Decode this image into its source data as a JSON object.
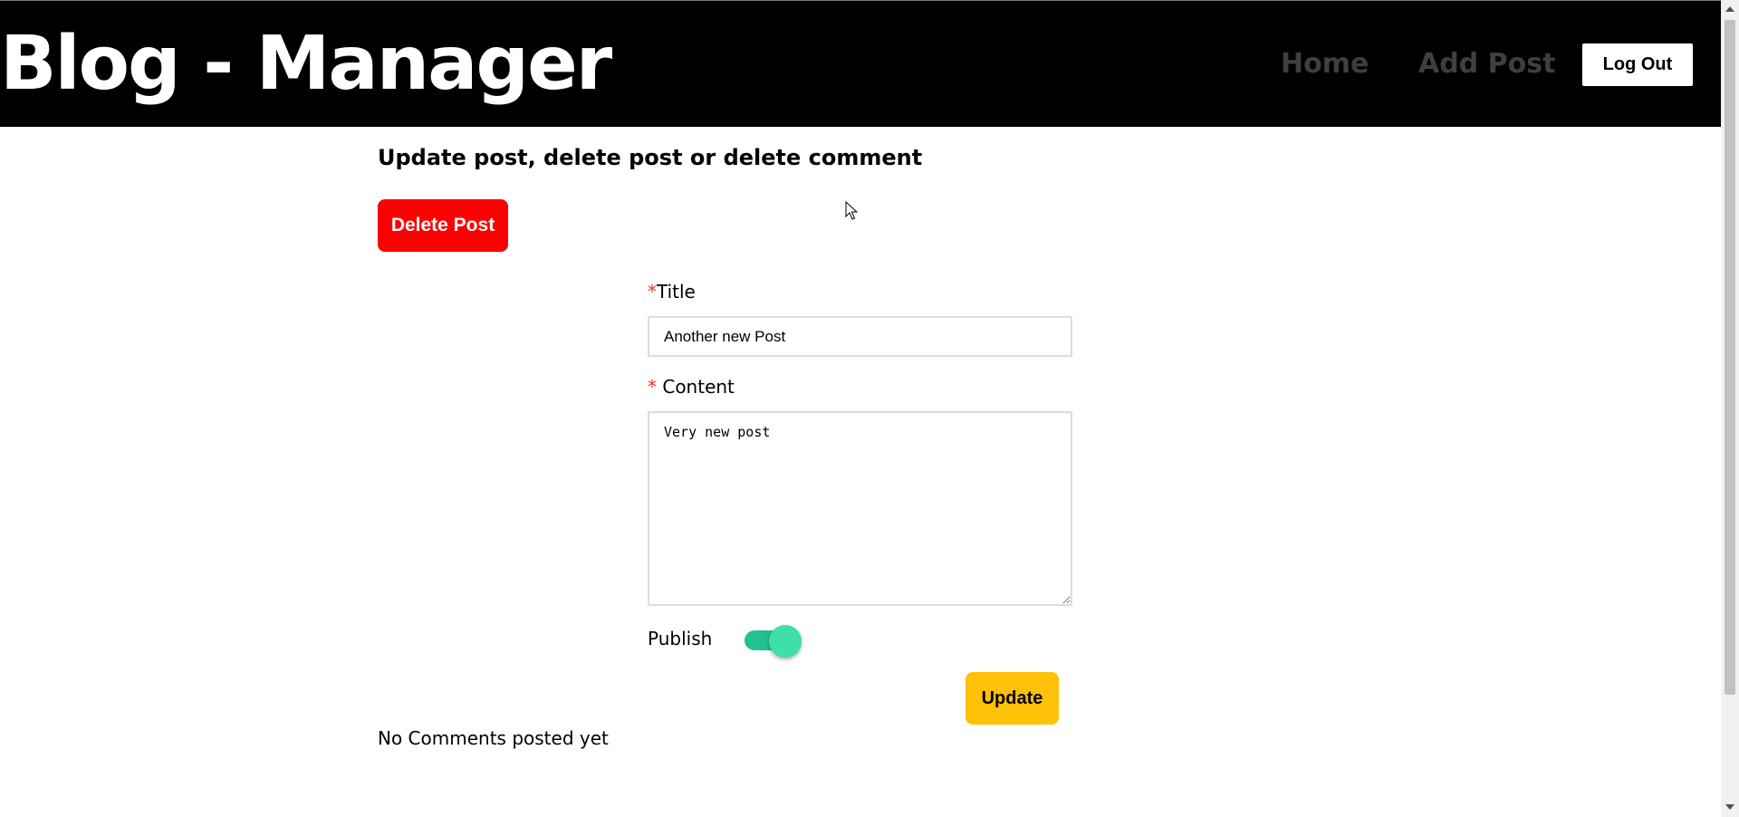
{
  "header": {
    "brand": "Blog - Manager",
    "nav": {
      "home": "Home",
      "add_post": "Add Post"
    },
    "logout_label": "Log Out"
  },
  "main": {
    "title": "Update post, delete post or delete comment",
    "delete_label": "Delete Post",
    "form": {
      "title_required_mark": "*",
      "title_label": "Title",
      "title_value": "Another new Post",
      "content_required_mark": "*",
      "content_label": " Content",
      "content_value": "Very new post",
      "publish_label": "Publish",
      "publish_on": true,
      "update_label": "Update"
    },
    "comments_empty": "No Comments posted yet"
  },
  "colors": {
    "header_bg": "#000000",
    "delete_button": "#ff0000",
    "update_button": "#ffc107",
    "toggle_on": "#3fdfab",
    "required_mark": "#ff2b2b"
  }
}
